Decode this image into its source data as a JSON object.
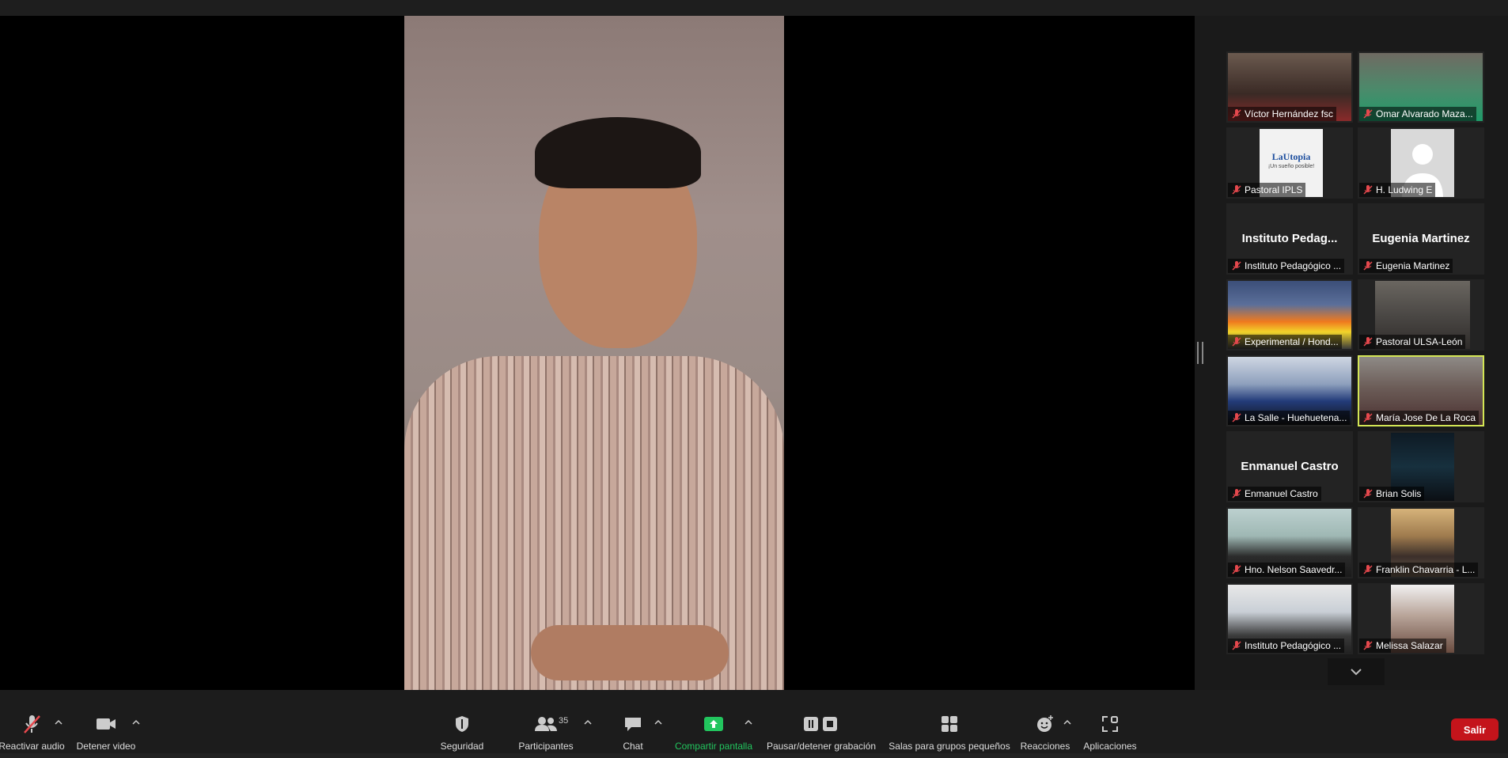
{
  "toolbar": {
    "audio_label": "Reactivar audio",
    "video_label": "Detener video",
    "security_label": "Seguridad",
    "participants_label": "Participantes",
    "participants_count": "35",
    "chat_label": "Chat",
    "share_label": "Compartir pantalla",
    "record_label": "Pausar/detener grabación",
    "rooms_label": "Salas para grupos pequeños",
    "reactions_label": "Reacciones",
    "apps_label": "Aplicaciones",
    "leave_label": "Salir"
  },
  "gallery": {
    "tiles": [
      {
        "name": "Víctor Hernández fsc",
        "big_name": ""
      },
      {
        "name": "Omar Alvarado Maza...",
        "big_name": ""
      },
      {
        "name": "Pastoral IPLS",
        "big_name": "",
        "logo_title": "LaUtopia",
        "logo_subtitle": "¡Un sueño posible!"
      },
      {
        "name": "H. Ludwing E",
        "big_name": ""
      },
      {
        "name": "Instituto Pedagógico ...",
        "big_name": "Instituto  Pedag..."
      },
      {
        "name": "Eugenia Martinez",
        "big_name": "Eugenia Martinez"
      },
      {
        "name": "Experimental / Hond...",
        "big_name": ""
      },
      {
        "name": "Pastoral ULSA-León",
        "big_name": ""
      },
      {
        "name": "La Salle - Huehuetena...",
        "big_name": ""
      },
      {
        "name": "María Jose De La Roca",
        "big_name": ""
      },
      {
        "name": "Enmanuel Castro",
        "big_name": "Enmanuel Castro"
      },
      {
        "name": "Brian Solis",
        "big_name": ""
      },
      {
        "name": "Hno. Nelson Saavedr...",
        "big_name": ""
      },
      {
        "name": "Franklin Chavarria - L...",
        "big_name": ""
      },
      {
        "name": "Instituto Pedagógico ...",
        "big_name": ""
      },
      {
        "name": "Melissa Salazar",
        "big_name": ""
      }
    ],
    "active_tile_index": 9
  },
  "colors": {
    "active_border": "#d3e655",
    "share_green": "#22c55e",
    "leave_red": "#c4141b",
    "mic_muted": "#e5484d"
  }
}
